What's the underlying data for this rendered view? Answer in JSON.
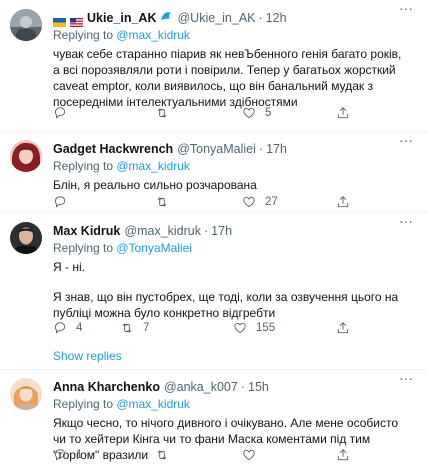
{
  "tweets": [
    {
      "name": "Ukie_in_AK",
      "handle": "@Ukie_in_AK",
      "sep": "·",
      "time": "12h",
      "replying_prefix": "Replying to ",
      "replying_to": "@max_kidruk",
      "text": "чувак себе старанно піарив як невЪбенного генія багато років, а всі порозявляли роти і повірили. Тепер у багатьох жорсткий caveat emptor, коли виявилось, що він банальний мудак з посередніми інтелектуальними здібностями",
      "reply_count": "",
      "retweet_count": "",
      "like_count": "5"
    },
    {
      "name": "Gadget Hackwrench",
      "handle": "@TonyaMaliei",
      "sep": "·",
      "time": "17h",
      "replying_prefix": "Replying to ",
      "replying_to": "@max_kidruk",
      "text": "Блін, я реально сильно розчарована",
      "reply_count": "",
      "retweet_count": "",
      "like_count": "27"
    },
    {
      "name": "Max Kidruk",
      "handle": "@max_kidruk",
      "sep": "·",
      "time": "17h",
      "replying_prefix": "Replying to ",
      "replying_to": "@TonyaMaliei",
      "text1": "Я - ні.",
      "text2": "Я знав, що він пустобрех, ще тоді, коли за озвучення цього на публіці можна було конкретно відгребти",
      "reply_count": "4",
      "retweet_count": "7",
      "like_count": "155"
    },
    {
      "name": "Anna Kharchenko",
      "handle": "@anka_k007",
      "sep": "·",
      "time": "15h",
      "replying_prefix": "Replying to ",
      "replying_to": "@max_kidruk",
      "text": "Якщо чесно, то нічого дивного і очікувано. Але мене особисто чи то хейтери Кінга чи то фани Маска коментами під тим \"торгом\" вразили",
      "reply_count": "1",
      "retweet_count": "",
      "like_count": ""
    }
  ],
  "show_replies": "Show replies",
  "more_glyph": "···",
  "colors": {
    "accent": "#1d9bf0",
    "muted": "#536471",
    "text": "#0f1419"
  }
}
